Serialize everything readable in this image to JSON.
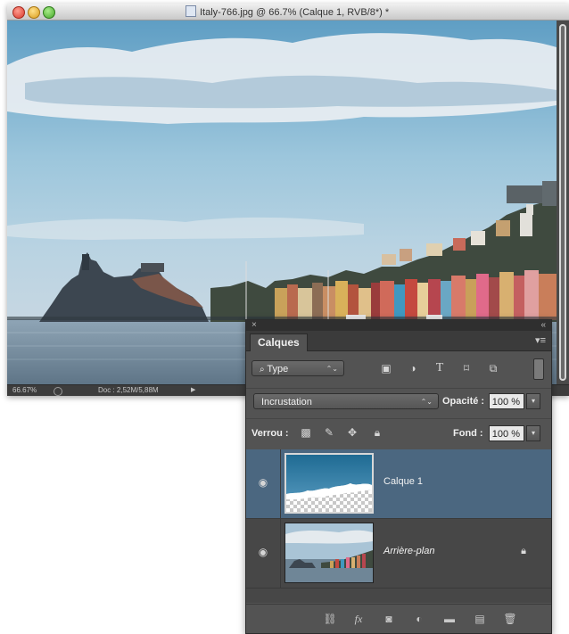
{
  "window": {
    "title": "Italy-766.jpg @ 66.7% (Calque 1, RVB/8*) *"
  },
  "status": {
    "zoom": "66.67%",
    "doc": "Doc : 2,52M/5,88M"
  },
  "panel": {
    "tab": "Calques",
    "filter_label": "Type",
    "blend_mode": "Incrustation",
    "opacity_label": "Opacité :",
    "opacity_value": "100 %",
    "lock_label": "Verrou :",
    "fill_label": "Fond :",
    "fill_value": "100 %",
    "layers": [
      {
        "name": "Calque 1",
        "selected": true
      },
      {
        "name": "Arrière-plan",
        "selected": false,
        "locked": true
      }
    ]
  },
  "colors": {
    "panel_bg": "#535353",
    "selected_layer": "#4b6780"
  }
}
